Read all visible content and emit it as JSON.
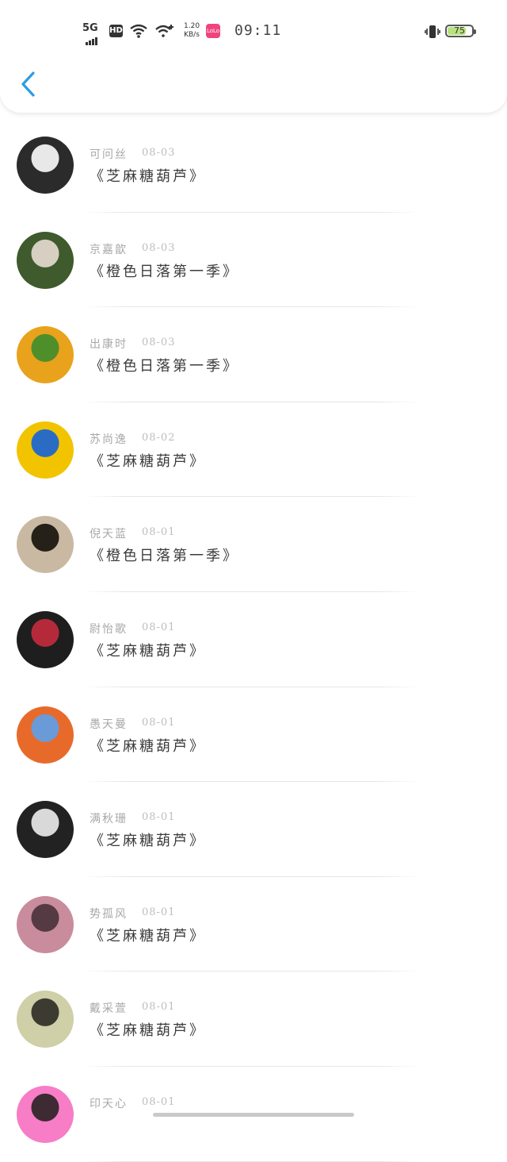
{
  "status_bar": {
    "network": "5G",
    "hd": "HD",
    "speed_value": "1.20",
    "speed_unit": "KB/s",
    "app_icon_text": "LoLo",
    "time": "09:11",
    "battery": "75",
    "battery_level": 0.75
  },
  "header": {
    "back_icon": "chevron-left-icon"
  },
  "list": [
    {
      "name": "可问丝",
      "date": "08-03",
      "title": "《芝麻糖葫芦》",
      "avatar_colors": [
        "#2b2b2b",
        "#e8e8e8"
      ]
    },
    {
      "name": "京嘉歆",
      "date": "08-03",
      "title": "《橙色日落第一季》",
      "avatar_colors": [
        "#3f5a2c",
        "#d8cfc3"
      ]
    },
    {
      "name": "出康时",
      "date": "08-03",
      "title": "《橙色日落第一季》",
      "avatar_colors": [
        "#e8a21c",
        "#4e8f2b"
      ]
    },
    {
      "name": "苏尚逸",
      "date": "08-02",
      "title": "《芝麻糖葫芦》",
      "avatar_colors": [
        "#f2c400",
        "#2a6cc4"
      ]
    },
    {
      "name": "倪天蓝",
      "date": "08-01",
      "title": "《橙色日落第一季》",
      "avatar_colors": [
        "#c9b9a2",
        "#252018"
      ]
    },
    {
      "name": "尉怡歌",
      "date": "08-01",
      "title": "《芝麻糖葫芦》",
      "avatar_colors": [
        "#1e1e1e",
        "#b52a3a"
      ]
    },
    {
      "name": "愚天曼",
      "date": "08-01",
      "title": "《芝麻糖葫芦》",
      "avatar_colors": [
        "#e86a2a",
        "#6a9ad8"
      ]
    },
    {
      "name": "满秋珊",
      "date": "08-01",
      "title": "《芝麻糖葫芦》",
      "avatar_colors": [
        "#222222",
        "#d9d9d9"
      ]
    },
    {
      "name": "势孤风",
      "date": "08-01",
      "title": "《芝麻糖葫芦》",
      "avatar_colors": [
        "#c98c9c",
        "#553a44"
      ]
    },
    {
      "name": "戴采萱",
      "date": "08-01",
      "title": "《芝麻糖葫芦》",
      "avatar_colors": [
        "#cfcfa8",
        "#3b3b32"
      ]
    },
    {
      "name": "印天心",
      "date": "08-01",
      "title": "",
      "avatar_colors": [
        "#f77dc6",
        "#3d2a33"
      ]
    }
  ]
}
